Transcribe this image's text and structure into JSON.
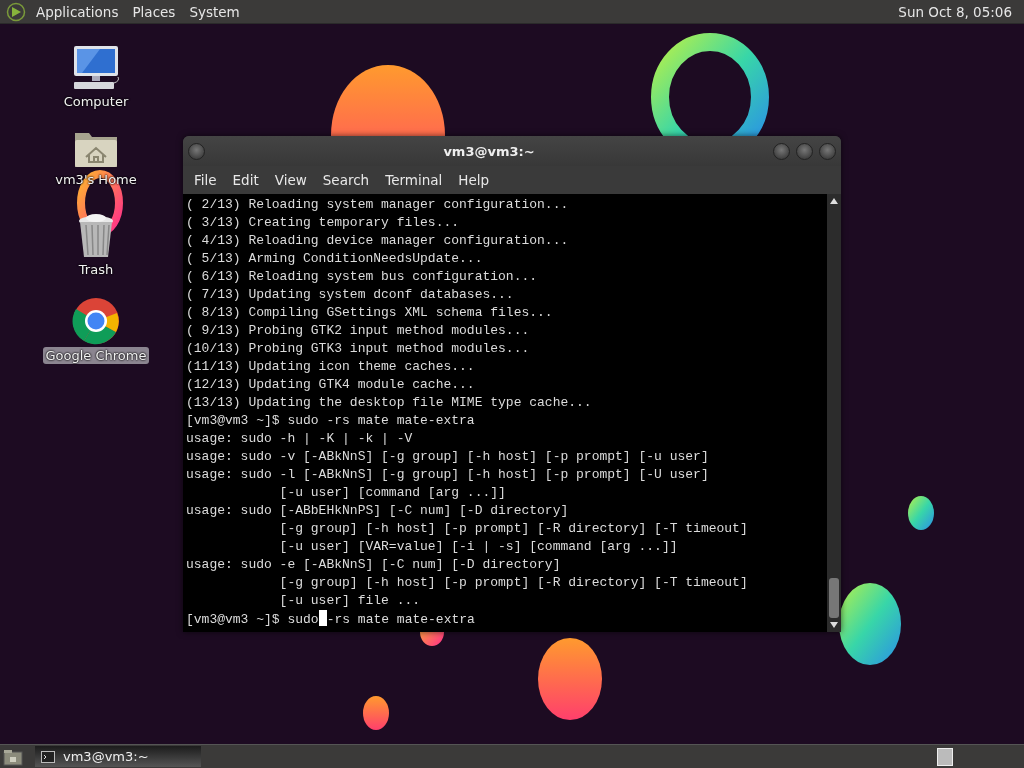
{
  "top_panel": {
    "menus": [
      {
        "label": "Applications"
      },
      {
        "label": "Places"
      },
      {
        "label": "System"
      }
    ],
    "clock": "Sun Oct  8, 05:06"
  },
  "desktop_icons": [
    {
      "kind": "computer",
      "label": "Computer",
      "selected": false
    },
    {
      "kind": "home",
      "label": "vm3's Home",
      "selected": false
    },
    {
      "kind": "trash",
      "label": "Trash",
      "selected": false
    },
    {
      "kind": "browser",
      "label": "Google Chrome",
      "selected": true
    }
  ],
  "window": {
    "title": "vm3@vm3:~",
    "menu": [
      "File",
      "Edit",
      "View",
      "Search",
      "Terminal",
      "Help"
    ],
    "terminal": {
      "lines": [
        "( 2/13) Reloading system manager configuration...",
        "( 3/13) Creating temporary files...",
        "( 4/13) Reloading device manager configuration...",
        "( 5/13) Arming ConditionNeedsUpdate...",
        "( 6/13) Reloading system bus configuration...",
        "( 7/13) Updating system dconf databases...",
        "( 8/13) Compiling GSettings XML schema files...",
        "( 9/13) Probing GTK2 input method modules...",
        "(10/13) Probing GTK3 input method modules...",
        "(11/13) Updating icon theme caches...",
        "(12/13) Updating GTK4 module cache...",
        "(13/13) Updating the desktop file MIME type cache...",
        "[vm3@vm3 ~]$ sudo -rs mate mate-extra",
        "usage: sudo -h | -K | -k | -V",
        "usage: sudo -v [-ABkNnS] [-g group] [-h host] [-p prompt] [-u user]",
        "usage: sudo -l [-ABkNnS] [-g group] [-h host] [-p prompt] [-U user]",
        "            [-u user] [command [arg ...]]",
        "usage: sudo [-ABbEHkNnPS] [-C num] [-D directory]",
        "            [-g group] [-h host] [-p prompt] [-R directory] [-T timeout]",
        "            [-u user] [VAR=value] [-i | -s] [command [arg ...]]",
        "usage: sudo -e [-ABkNnS] [-C num] [-D directory]",
        "            [-g group] [-h host] [-p prompt] [-R directory] [-T timeout]",
        "            [-u user] file ..."
      ],
      "input_before_cursor": "[vm3@vm3 ~]$ sudo",
      "input_after_cursor": "-rs mate mate-extra"
    }
  },
  "taskbar": {
    "tasks": [
      {
        "label": "vm3@vm3:~",
        "selected": true
      }
    ]
  }
}
